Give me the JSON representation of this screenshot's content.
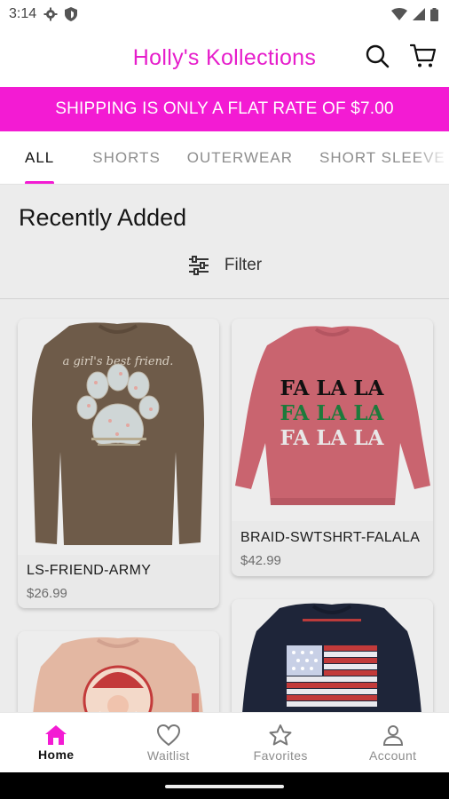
{
  "status": {
    "time": "3:14"
  },
  "app": {
    "title": "Holly's Kollections",
    "accent": "#f31bd3"
  },
  "banner": {
    "text": "SHIPPING IS ONLY A FLAT RATE OF $7.00"
  },
  "tabs": [
    {
      "label": "ALL",
      "active": true
    },
    {
      "label": "SHORTS"
    },
    {
      "label": "OUTERWEAR"
    },
    {
      "label": "SHORT SLEEVE"
    }
  ],
  "main": {
    "section_title": "Recently Added",
    "filter_label": "Filter"
  },
  "products": [
    {
      "name": "LS-FRIEND-ARMY",
      "price": "$26.99",
      "print_text": "a girl's best friend."
    },
    {
      "name": "BRAID-SWTSHRT-FALALA",
      "price": "$42.99",
      "print_text": "FA LA LA"
    },
    {
      "name": "",
      "price": ""
    },
    {
      "name": "",
      "price": ""
    }
  ],
  "bottom_nav": [
    {
      "label": "Home",
      "icon": "home-icon",
      "active": true
    },
    {
      "label": "Waitlist",
      "icon": "heart-icon"
    },
    {
      "label": "Favorites",
      "icon": "star-icon"
    },
    {
      "label": "Account",
      "icon": "account-icon"
    }
  ]
}
